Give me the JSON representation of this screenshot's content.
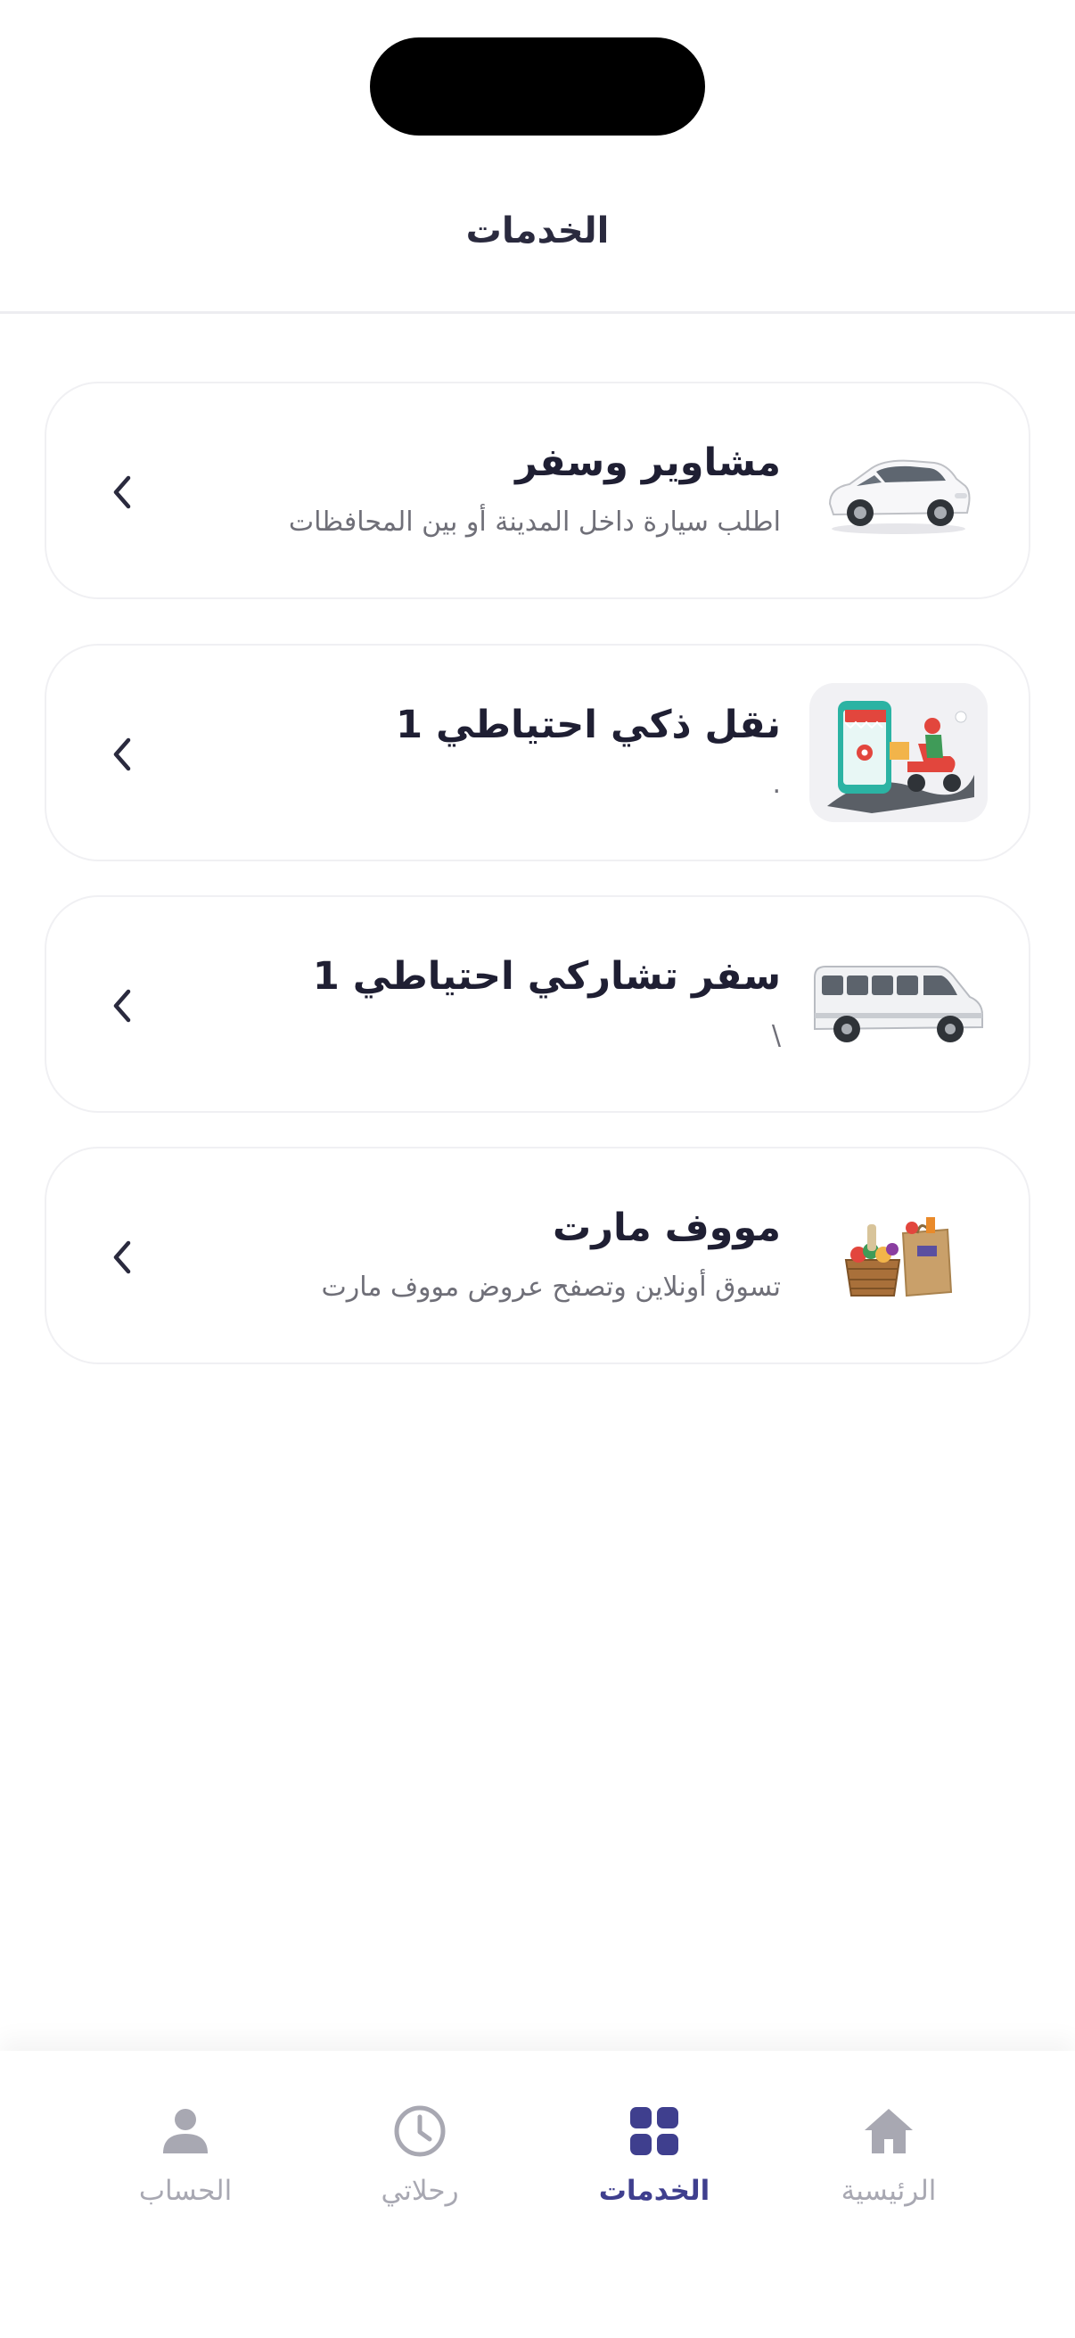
{
  "header": {
    "title": "الخدمات"
  },
  "services": [
    {
      "title": "مشاوير وسفر",
      "subtitle": "اطلب سيارة داخل المدينة أو بين المحافظات",
      "icon": "car-icon"
    },
    {
      "title": "نقل ذكي احتياطي 1",
      "subtitle": ".",
      "icon": "delivery-scooter-icon"
    },
    {
      "title": "سفر تشاركي احتياطي 1",
      "subtitle": "\\",
      "icon": "minibus-icon"
    },
    {
      "title": "مووف مارت",
      "subtitle": "تسوق أونلاين وتصفح عروض مووف مارت",
      "icon": "grocery-bag-icon"
    }
  ],
  "nav": {
    "items": [
      {
        "label": "الرئيسية",
        "icon": "home-icon",
        "active": false
      },
      {
        "label": "الخدمات",
        "icon": "grid-icon",
        "active": true
      },
      {
        "label": "رحلاتي",
        "icon": "clock-icon",
        "active": false
      },
      {
        "label": "الحساب",
        "icon": "user-icon",
        "active": false
      }
    ]
  },
  "colors": {
    "accent": "#3f3f8e",
    "inactive": "#a8a8b2",
    "title": "#1f1f33",
    "subtitle": "#6f6f78"
  }
}
